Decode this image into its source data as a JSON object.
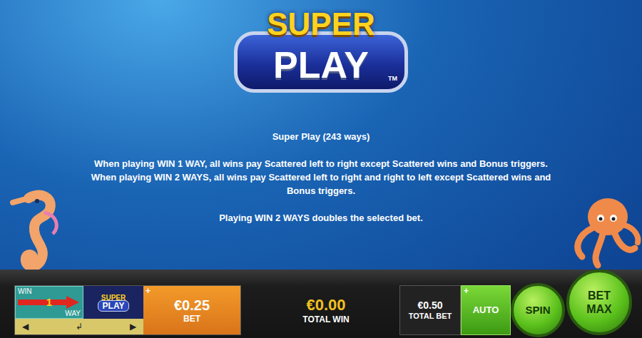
{
  "logo": {
    "line1": "SUPER",
    "line2": "PLAY",
    "mark": "TM"
  },
  "help": {
    "title": "Super Play (243 ways)",
    "paragraphs": [
      "When playing WIN 1 WAY, all wins pay Scattered left to right except Scattered wins and Bonus triggers.",
      "When playing WIN 2 WAYS, all wins pay Scattered left to right and right to left except Scattered wins and Bonus triggers."
    ],
    "note": "Playing WIN 2 WAYS doubles the selected bet."
  },
  "controls": {
    "win_ways": {
      "top": "WIN",
      "number": "1",
      "bottom": "WAY"
    },
    "mini_logo": {
      "line1": "SUPER",
      "line2": "PLAY"
    },
    "nav": [
      "◀",
      "↲",
      "▶"
    ],
    "bet": {
      "plus": "+",
      "value": "€0.25",
      "label": "BET"
    },
    "total_win": {
      "value": "€0.00",
      "label": "TOTAL WIN"
    },
    "total_bet": {
      "value": "€0.50",
      "label": "TOTAL BET"
    },
    "auto": {
      "plus": "+",
      "label": "AUTO"
    },
    "spin": "SPIN",
    "bet_max": [
      "BET",
      "MAX"
    ]
  }
}
